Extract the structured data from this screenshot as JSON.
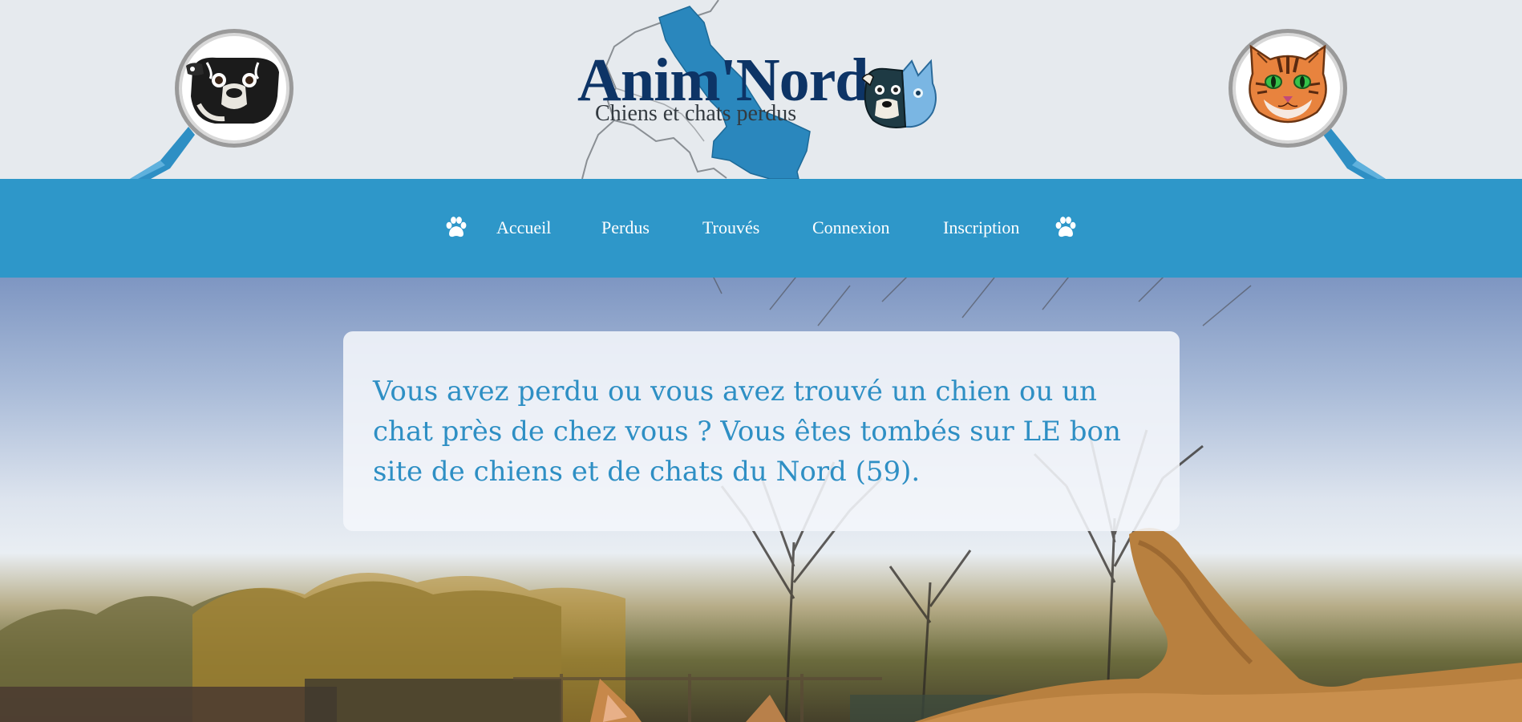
{
  "header": {
    "brand_title": "Anim'Nord",
    "brand_subtitle": "Chiens et chats perdus",
    "icons": [
      "dog-magnifier-icon",
      "map-icon",
      "dog-cat-mascot-icon",
      "cat-magnifier-icon"
    ]
  },
  "nav": {
    "items": [
      {
        "label": "Accueil"
      },
      {
        "label": "Perdus"
      },
      {
        "label": "Trouvés"
      },
      {
        "label": "Connexion"
      },
      {
        "label": "Inscription"
      }
    ],
    "icons": [
      "paw-icon",
      "paw-icon"
    ]
  },
  "hero": {
    "intro_text": "Vous avez perdu ou vous avez trouvé un chien ou un chat près de chez vous ? Vous êtes tombés sur LE bon site de chiens et de chats du Nord (59)."
  },
  "colors": {
    "header_bg": "#e6eaee",
    "nav_bg": "#2e97c9",
    "brand_title": "#0d3466",
    "intro_text": "#2e8fc4",
    "map_fill": "#2a87bd",
    "magnifier_handle": "#2e8fc4"
  }
}
